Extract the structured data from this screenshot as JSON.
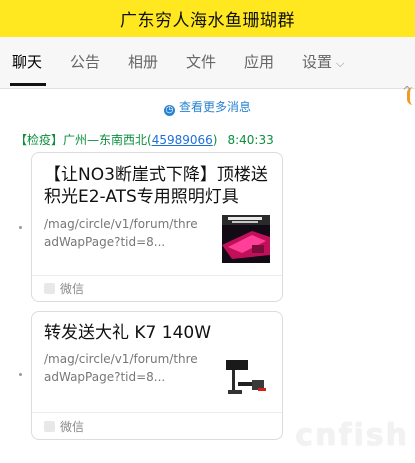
{
  "window": {
    "title": "广东穷人海水鱼珊瑚群"
  },
  "tabs": [
    {
      "label": "聊天",
      "active": true
    },
    {
      "label": "公告"
    },
    {
      "label": "相册"
    },
    {
      "label": "文件"
    },
    {
      "label": "应用"
    },
    {
      "label": "设置"
    }
  ],
  "load_more": "查看更多消息",
  "message": {
    "sender_prefix": "【检疫】广州—东南西北(",
    "sender_qq": "45989066",
    "sender_suffix": ")",
    "time": "8:40:33"
  },
  "cards": [
    {
      "title_line1": "【让NO3断崖式下降】顶楼送",
      "title_line2": "积光E2-ATS专用照明灯具",
      "link_line1": "/mag/circle/v1/forum/thre",
      "link_line2": "adWapPage?tid=8...",
      "source": "微信"
    },
    {
      "title_line1": "转发送大礼 K7 140W",
      "link_line1": "/mag/circle/v1/forum/thre",
      "link_line2": "adWapPage?tid=8...",
      "source": "微信"
    }
  ],
  "watermark": "cnfish",
  "colors": {
    "titlebar": "#ffe81f",
    "sender": "#0a8f3c",
    "link": "#1e6fd8",
    "accent": "#f29b23"
  }
}
